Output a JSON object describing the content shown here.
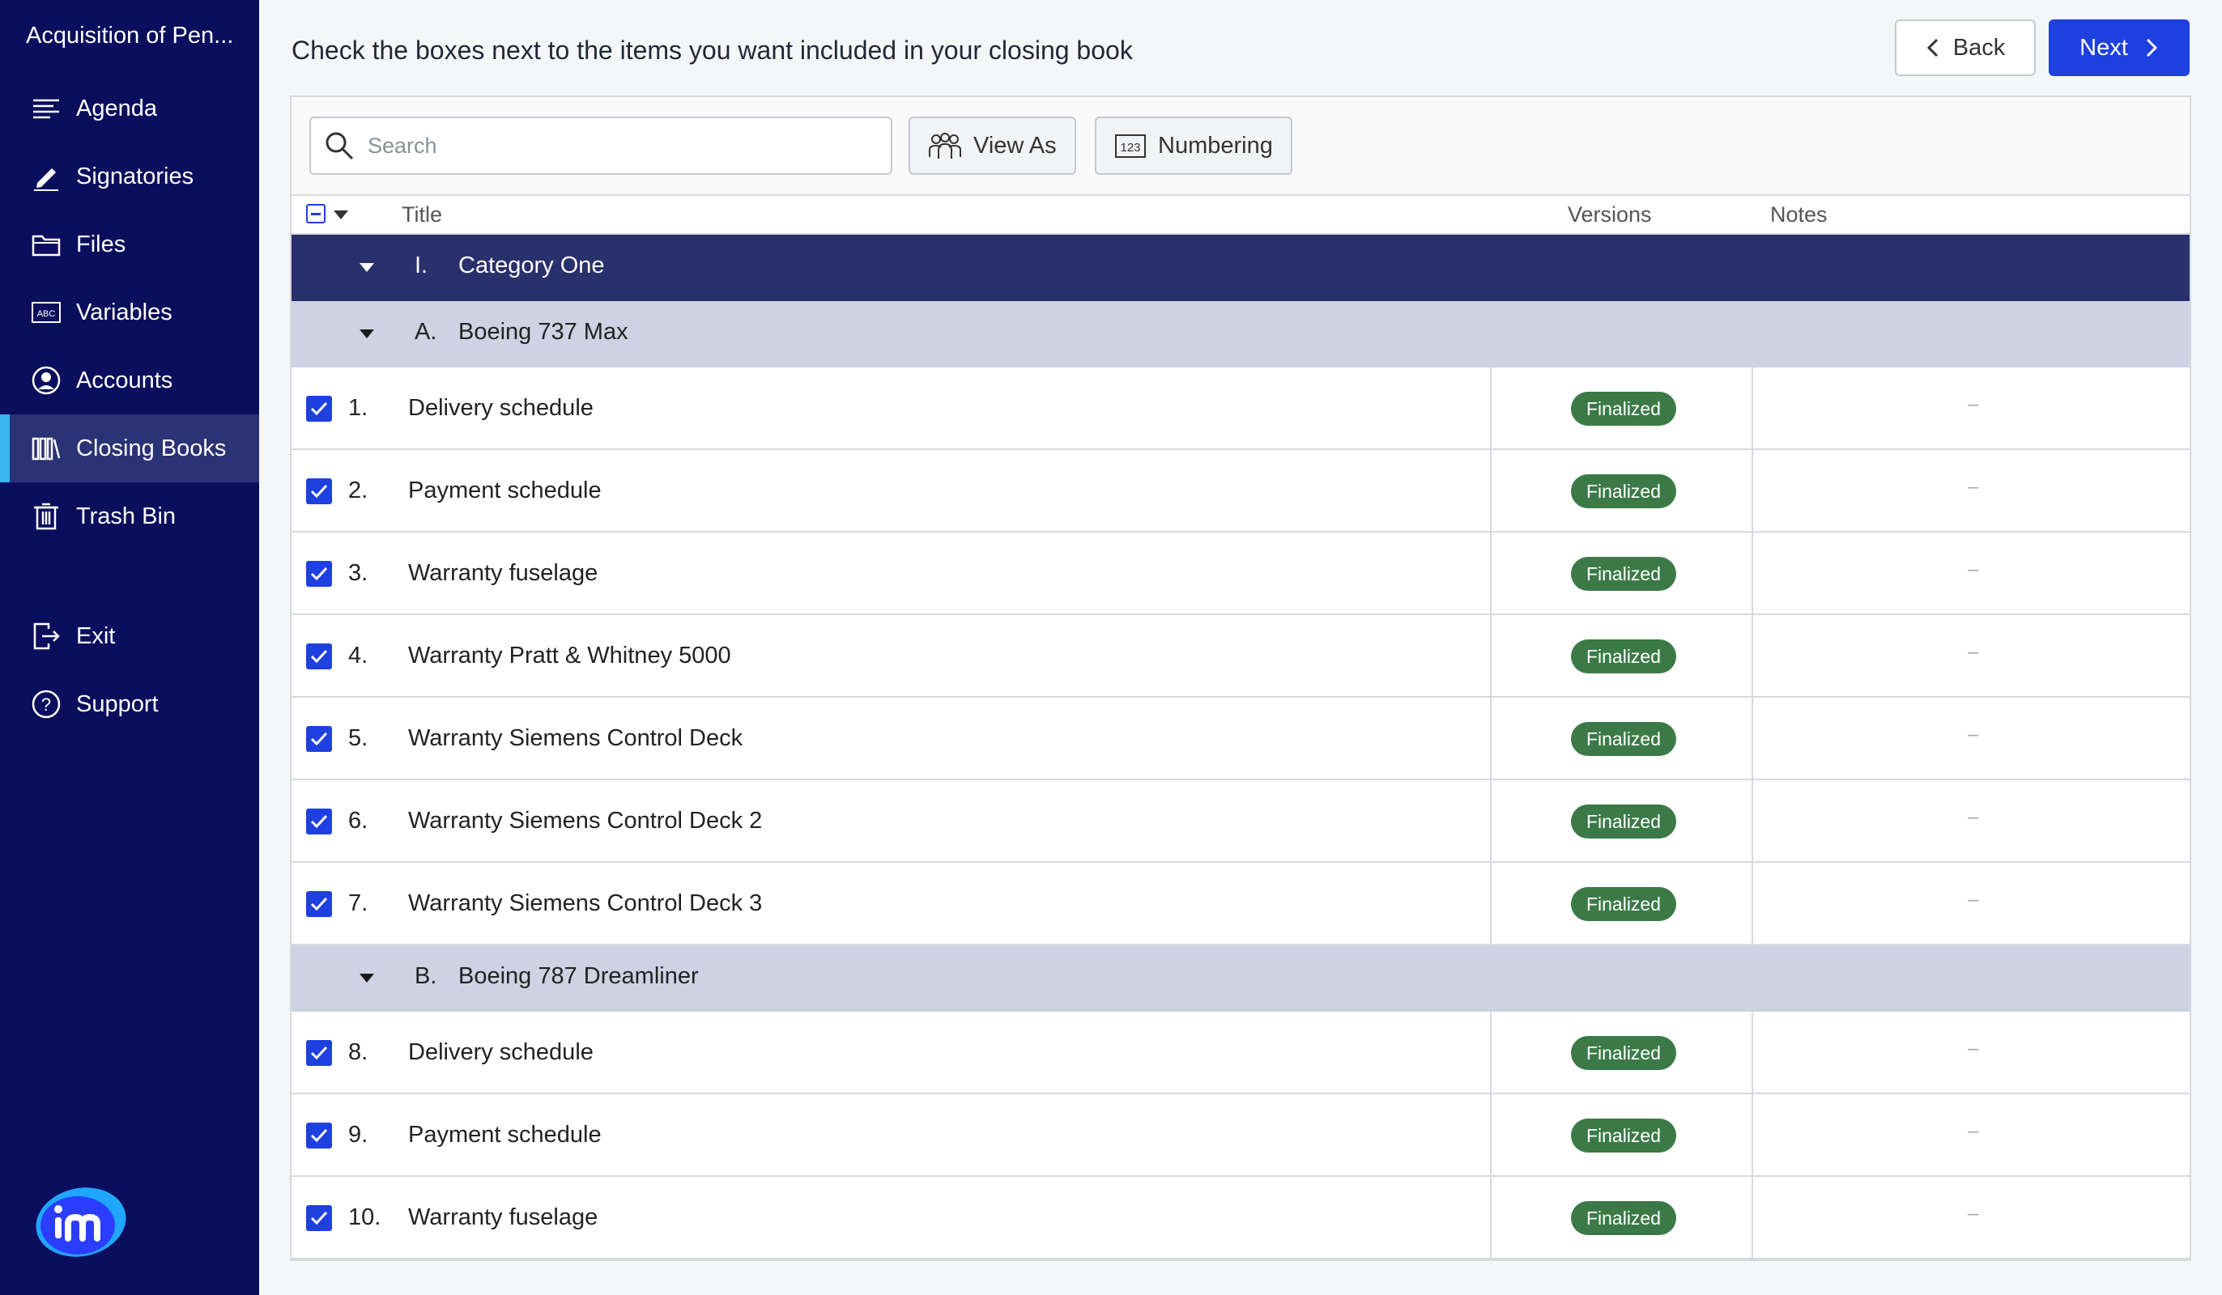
{
  "sidebar": {
    "deal_title": "Acquisition of Pen...",
    "items": [
      {
        "label": "Agenda",
        "icon": "agenda-icon",
        "active": false
      },
      {
        "label": "Signatories",
        "icon": "pen-icon",
        "active": false
      },
      {
        "label": "Files",
        "icon": "folder-icon",
        "active": false
      },
      {
        "label": "Variables",
        "icon": "abc-icon",
        "active": false
      },
      {
        "label": "Accounts",
        "icon": "user-icon",
        "active": false
      },
      {
        "label": "Closing Books",
        "icon": "books-icon",
        "active": true
      },
      {
        "label": "Trash Bin",
        "icon": "trash-icon",
        "active": false
      }
    ],
    "exit_label": "Exit",
    "support_label": "Support",
    "logo": "im-logo"
  },
  "header": {
    "heading": "Check the boxes next to the items you want included in your closing book",
    "back_label": "Back",
    "next_label": "Next"
  },
  "toolbar": {
    "search_placeholder": "Search",
    "view_as_label": "View As",
    "numbering_label": "Numbering"
  },
  "columns": {
    "title": "Title",
    "versions": "Versions",
    "notes": "Notes"
  },
  "category": {
    "number": "I.",
    "title": "Category One"
  },
  "groups": [
    {
      "number": "A.",
      "title": "Boeing 737 Max",
      "items": [
        {
          "number": "1.",
          "title": "Delivery schedule",
          "status": "Finalized",
          "notes": "–"
        },
        {
          "number": "2.",
          "title": "Payment schedule",
          "status": "Finalized",
          "notes": "–"
        },
        {
          "number": "3.",
          "title": "Warranty fuselage",
          "status": "Finalized",
          "notes": "–"
        },
        {
          "number": "4.",
          "title": "Warranty Pratt & Whitney 5000",
          "status": "Finalized",
          "notes": "–"
        },
        {
          "number": "5.",
          "title": "Warranty Siemens Control Deck",
          "status": "Finalized",
          "notes": "–"
        },
        {
          "number": "6.",
          "title": "Warranty Siemens Control Deck 2",
          "status": "Finalized",
          "notes": "–"
        },
        {
          "number": "7.",
          "title": "Warranty Siemens Control Deck 3",
          "status": "Finalized",
          "notes": "–"
        }
      ]
    },
    {
      "number": "B.",
      "title": "Boeing 787 Dreamliner",
      "items": [
        {
          "number": "8.",
          "title": "Delivery schedule",
          "status": "Finalized",
          "notes": "–"
        },
        {
          "number": "9.",
          "title": "Payment schedule",
          "status": "Finalized",
          "notes": "–"
        },
        {
          "number": "10.",
          "title": "Warranty fuselage",
          "status": "Finalized",
          "notes": "–"
        }
      ]
    }
  ],
  "colors": {
    "sidebar_bg": "#0a0e5c",
    "sidebar_active": "#2b3275",
    "accent": "#1e40e0",
    "category_bg": "#2a306b",
    "group_bg": "#cdd3e2",
    "badge_bg": "#3b7a47"
  }
}
